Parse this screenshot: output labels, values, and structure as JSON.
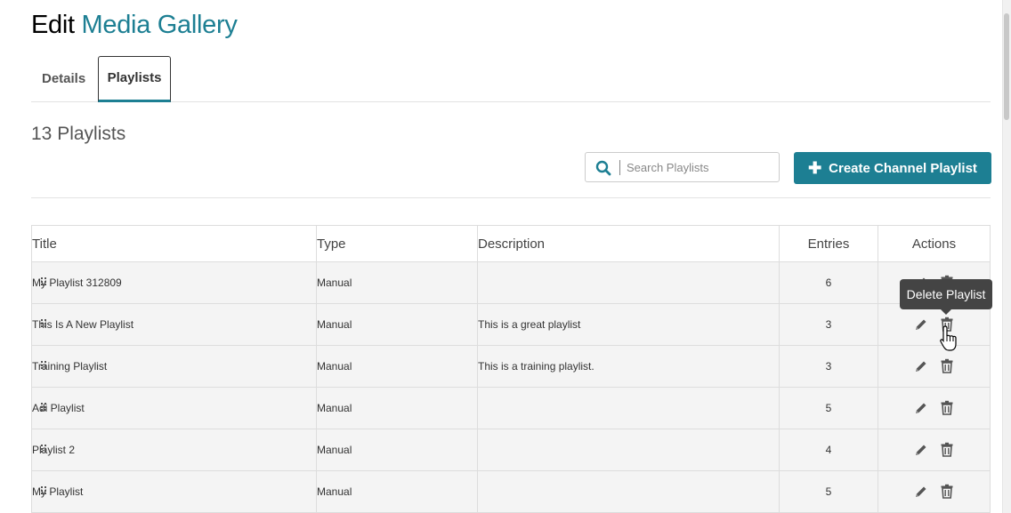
{
  "page": {
    "title_prefix": "Edit",
    "title_name": "Media Gallery"
  },
  "tabs": [
    {
      "label": "Details",
      "active": false
    },
    {
      "label": "Playlists",
      "active": true
    }
  ],
  "playlists_count": "13 Playlists",
  "search": {
    "placeholder": "Search Playlists",
    "value": ""
  },
  "create_button": {
    "label": "Create Channel Playlist",
    "icon": "plus-icon"
  },
  "table": {
    "headers": [
      "Title",
      "Type",
      "Description",
      "Entries",
      "Actions"
    ],
    "rows": [
      {
        "title": "My Playlist 312809",
        "type": "Manual",
        "description": "",
        "entries": "6"
      },
      {
        "title": "This Is A New Playlist",
        "type": "Manual",
        "description": "This is a great playlist",
        "entries": "3"
      },
      {
        "title": "Training Playlist",
        "type": "Manual",
        "description": "This is a training playlist.",
        "entries": "3"
      },
      {
        "title": "Adi Playlist",
        "type": "Manual",
        "description": "",
        "entries": "5"
      },
      {
        "title": "Playlist 2",
        "type": "Manual",
        "description": "",
        "entries": "4"
      },
      {
        "title": "My Playlist",
        "type": "Manual",
        "description": "",
        "entries": "5"
      }
    ]
  },
  "tooltip": {
    "text": "Delete Playlist"
  },
  "colors": {
    "accent": "#1d7f93",
    "row_bg": "#f4f4f4",
    "tooltip_bg": "#444444"
  },
  "icons": {
    "search": "search-icon",
    "drag": "drag-handle-icon",
    "edit": "pencil-icon",
    "delete": "trash-icon"
  }
}
